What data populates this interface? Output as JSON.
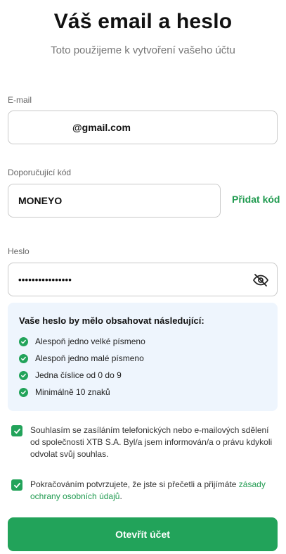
{
  "header": {
    "title": "Váš email a heslo",
    "subtitle": "Toto použijeme k vytvoření vašeho účtu"
  },
  "email": {
    "label": "E-mail",
    "value": "@gmail.com"
  },
  "referral": {
    "label": "Doporučující kód",
    "value": "MONEYO",
    "add_label": "Přidat kód"
  },
  "password": {
    "label": "Heslo",
    "value": "••••••••••••••••",
    "toggle_icon": "eye-slash-icon"
  },
  "password_rules": {
    "title": "Vaše heslo by mělo obsahovat následující:",
    "items": [
      {
        "label": "Alespoň jedno velké písmeno"
      },
      {
        "label": "Alespoň jedno malé písmeno"
      },
      {
        "label": "Jedna číslice od 0 do 9"
      },
      {
        "label": "Minimálně 10 znaků"
      }
    ]
  },
  "consents": {
    "marketing": "Souhlasím se zasíláním telefonických nebo e-mailových sdělení od společnosti XTB S.A. Byl/a jsem informován/a o právu kdykoli odvolat svůj souhlas.",
    "privacy_prefix": "Pokračováním potvrzujete, že jste si přečetli a přijímáte ",
    "privacy_link": "zásady ochrany osobních údajů",
    "privacy_suffix": "."
  },
  "submit": {
    "label": "Otevřít účet"
  },
  "colors": {
    "accent": "#22a35a",
    "link": "#1f9a4f",
    "rules_bg": "#eef5fd"
  }
}
